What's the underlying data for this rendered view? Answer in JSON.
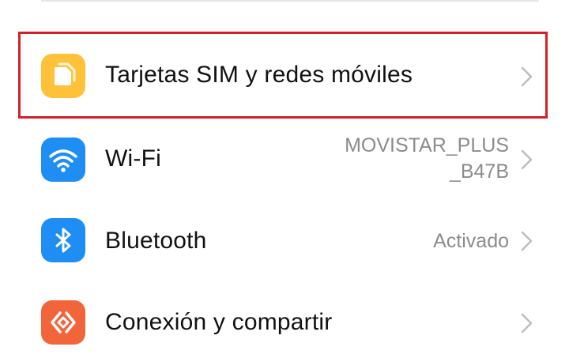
{
  "settings": {
    "items": [
      {
        "label": "Tarjetas SIM y redes móviles",
        "value_lines": [],
        "icon": "sim-card-icon",
        "icon_color": "#ffc13a",
        "highlighted": true
      },
      {
        "label": "Wi-Fi",
        "value_lines": [
          "MOVISTAR_PLUS",
          "_B47B"
        ],
        "icon": "wifi-icon",
        "icon_color": "#1e8ef5",
        "highlighted": false
      },
      {
        "label": "Bluetooth",
        "value_lines": [
          "Activado"
        ],
        "icon": "bluetooth-icon",
        "icon_color": "#1e8ef5",
        "highlighted": false
      },
      {
        "label": "Conexión y compartir",
        "value_lines": [],
        "icon": "connection-sharing-icon",
        "icon_color": "#f2653a",
        "highlighted": false
      }
    ]
  },
  "colors": {
    "highlight_border": "#d41f26",
    "label_text": "#111111",
    "value_text": "#8c8c8c",
    "chevron": "#bdbdbd"
  }
}
